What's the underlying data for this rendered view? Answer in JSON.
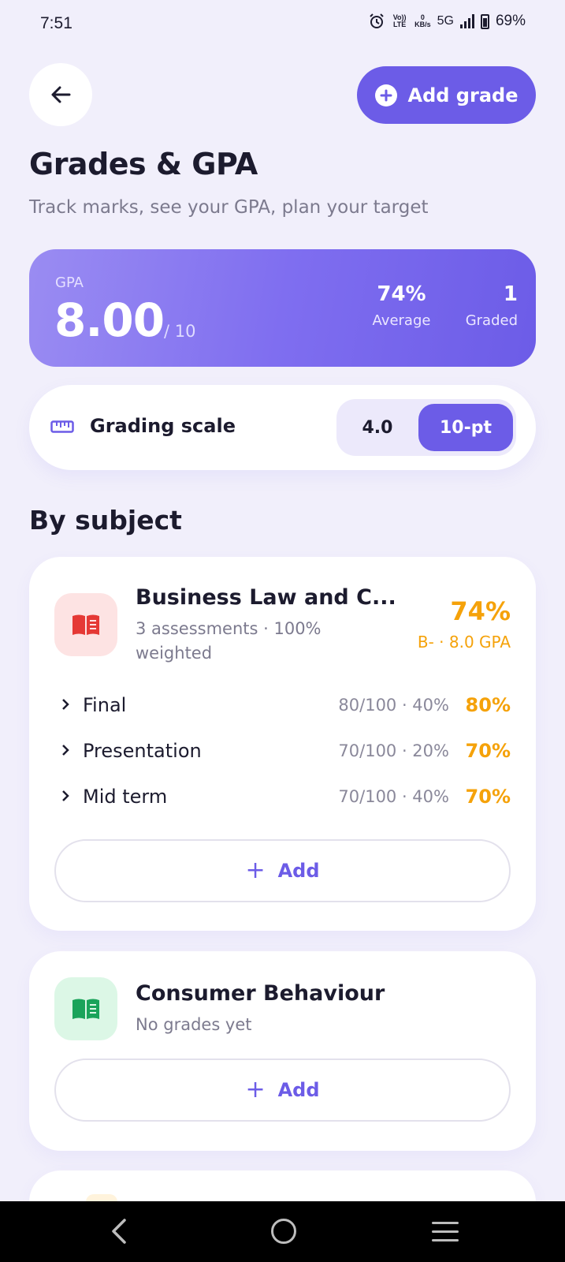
{
  "status_bar": {
    "time": "7:51",
    "volte": "Vo)) LTE",
    "data_rate": "0",
    "data_unit": "KB/s",
    "network": "5G",
    "battery": "69%",
    "icons": [
      "alarm-icon",
      "signal-icon",
      "battery-icon"
    ]
  },
  "header": {
    "back_icon": "arrow-left-icon",
    "add_grade_label": "Add grade"
  },
  "page": {
    "title": "Grades & GPA",
    "subtitle": "Track marks, see your GPA, plan your target"
  },
  "gpa_card": {
    "label": "GPA",
    "value": "8.00",
    "scale": "/ 10",
    "average_value": "74%",
    "average_label": "Average",
    "graded_value": "1",
    "graded_label": "Graded"
  },
  "grading_scale": {
    "label": "Grading scale",
    "options": [
      "4.0",
      "10-pt"
    ],
    "selected": "10-pt"
  },
  "section_title": "By subject",
  "subjects": [
    {
      "title": "Business Law and C...",
      "meta_line1": "3 assessments · 100%",
      "meta_line2": "weighted",
      "percent": "74%",
      "grade_gpa": "B- · 8.0 GPA",
      "icon": "book-icon",
      "icon_color": "#e53935",
      "assessments": [
        {
          "name": "Final",
          "score": "80/100 · 40%",
          "percent": "80%"
        },
        {
          "name": "Presentation",
          "score": "70/100 · 20%",
          "percent": "70%"
        },
        {
          "name": "Mid term",
          "score": "70/100 · 40%",
          "percent": "70%"
        }
      ],
      "add_label": "Add"
    },
    {
      "title": "Consumer Behaviour",
      "meta_line1": "No grades yet",
      "icon": "book-icon",
      "icon_color": "#1aa35a",
      "add_label": "Add"
    }
  ],
  "colors": {
    "accent": "#6c5ce7",
    "grade": "#f5a20a",
    "background": "#f1effb"
  }
}
